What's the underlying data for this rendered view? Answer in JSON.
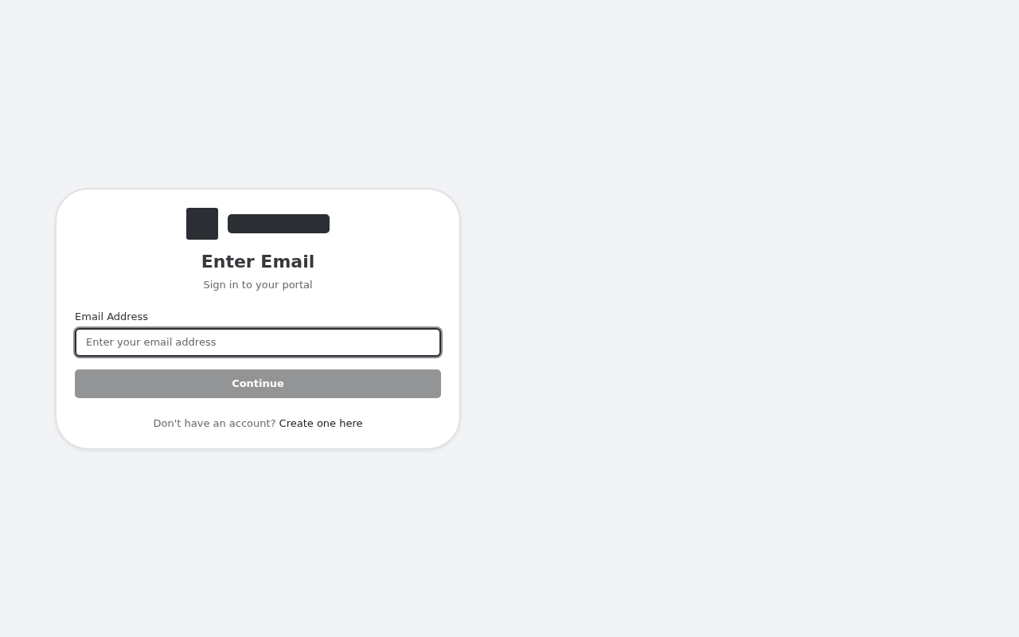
{
  "card": {
    "title": "Enter Email",
    "subtitle": "Sign in to your portal"
  },
  "email_field": {
    "label": "Email Address",
    "placeholder": "Enter your email address",
    "focused": true
  },
  "continue_button": {
    "label": "Continue",
    "disabled": true
  },
  "footer": {
    "text": "Don't have an account?",
    "link": "Create one here"
  }
}
